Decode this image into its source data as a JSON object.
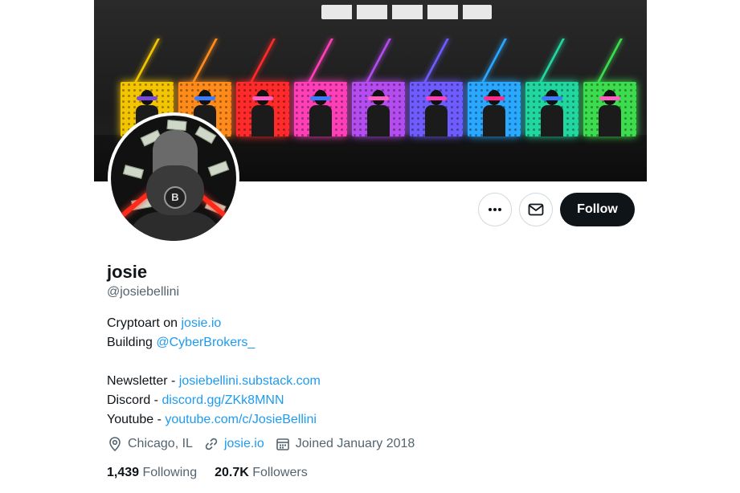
{
  "banner": {
    "panel_colors": [
      "#f2c500",
      "#ff8c1a",
      "#ff2a2a",
      "#ff3fb8",
      "#b44cf0",
      "#6f5cff",
      "#2aa8ff",
      "#22d6a0",
      "#3ddc4f"
    ],
    "band_colors": [
      "#7a4bd8",
      "#3b7cff",
      "#ff5fc0",
      "#3b7cff",
      "#ff5fc0",
      "#ff3fb8",
      "#ff2a8a",
      "#3b7cff",
      "#ff5fc0"
    ]
  },
  "avatar": {
    "badge_letter": "B"
  },
  "actions": {
    "more_icon": "more-horizontal-icon",
    "message_icon": "envelope-icon",
    "follow_label": "Follow"
  },
  "profile": {
    "display_name": "josie",
    "handle": "@josiebellini"
  },
  "bio": {
    "line1_text": "Cryptoart on ",
    "line1_link": "josie.io",
    "line2_text": "Building ",
    "line2_link": "@CyberBrokers_",
    "line4_text": "Newsletter - ",
    "line4_link": "josiebellini.substack.com",
    "line5_text": "Discord - ",
    "line5_link": "discord.gg/ZKk8MNN",
    "line6_text": "Youtube - ",
    "line6_link": "youtube.com/c/JosieBellini"
  },
  "meta": {
    "location": "Chicago, IL",
    "location_icon": "location-pin-icon",
    "website": "josie.io",
    "website_icon": "link-icon",
    "joined": "Joined January 2018",
    "joined_icon": "calendar-icon"
  },
  "stats": {
    "following_count": "1,439",
    "following_label": "Following",
    "followers_count": "20.7K",
    "followers_label": "Followers"
  },
  "colors": {
    "link": "#1d9bf0",
    "secondary_text": "#536471",
    "primary_text": "#0f1419",
    "follow_bg": "#0f1419"
  }
}
